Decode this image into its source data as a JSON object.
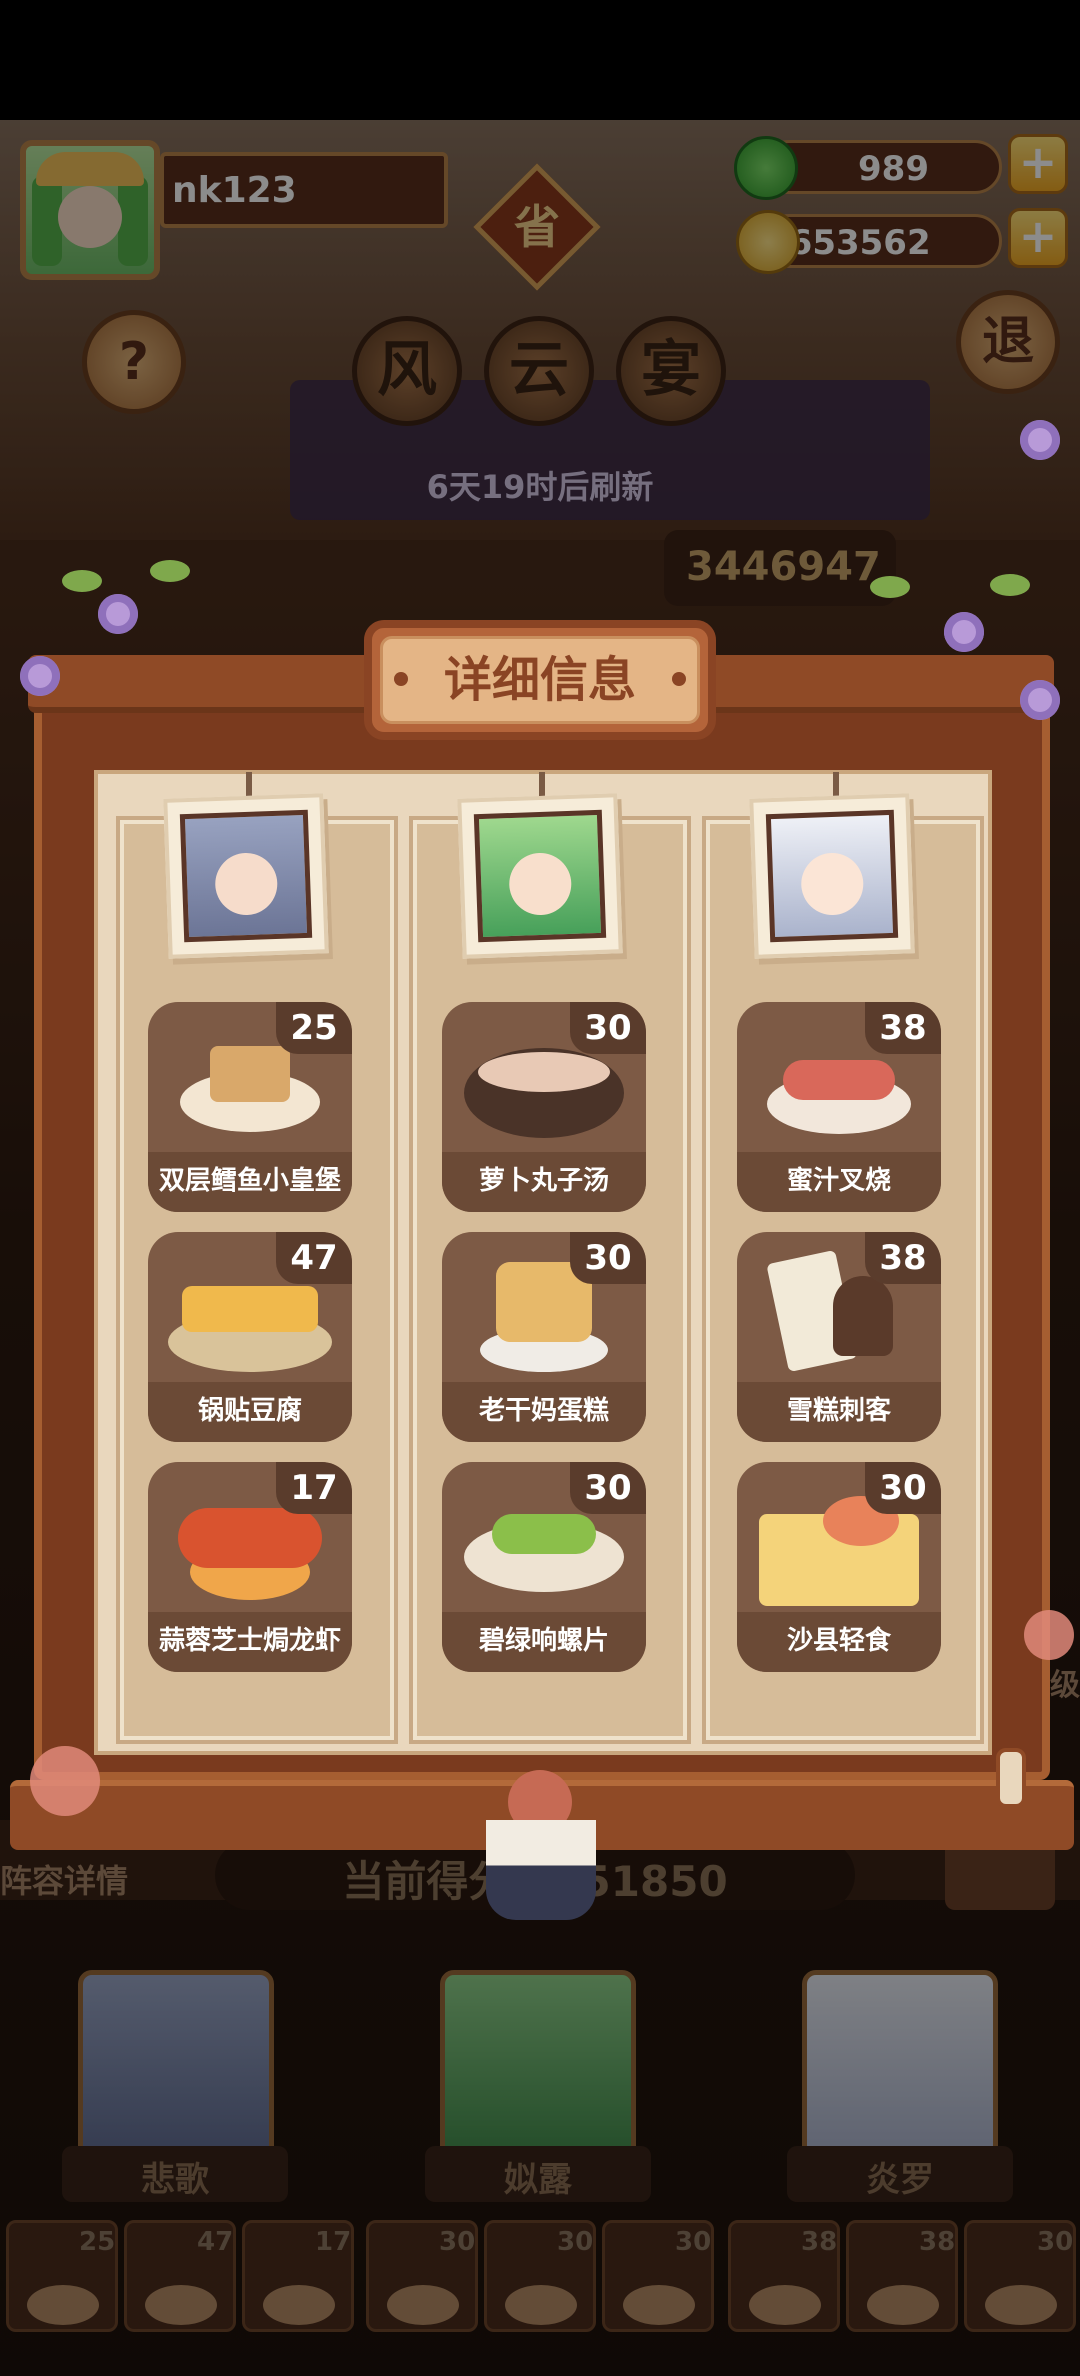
{
  "player": {
    "name": "nk123"
  },
  "resources": {
    "gems": "989",
    "coins": "1653562"
  },
  "header": {
    "help_label": "?",
    "exit_label": "退",
    "province_label": "省",
    "title_chars": [
      "风",
      "云",
      "宴"
    ],
    "refresh_text": "6天19时后刷新",
    "score_chip": "3446947"
  },
  "panel": {
    "title": "详细信息",
    "columns": [
      {
        "character": "悲歌",
        "dishes": [
          {
            "name": "双层鳕鱼小皇堡",
            "value": "25"
          },
          {
            "name": "锅贴豆腐",
            "value": "47"
          },
          {
            "name": "蒜蓉芝士焗龙虾",
            "value": "17"
          }
        ]
      },
      {
        "character": "姒露",
        "dishes": [
          {
            "name": "萝卜丸子汤",
            "value": "30"
          },
          {
            "name": "老干妈蛋糕",
            "value": "30"
          },
          {
            "name": "碧绿响螺片",
            "value": "30"
          }
        ]
      },
      {
        "character": "炎罗",
        "dishes": [
          {
            "name": "蜜汁叉烧",
            "value": "38"
          },
          {
            "name": "雪糕刺客",
            "value": "38"
          },
          {
            "name": "沙县轻食",
            "value": "30"
          }
        ]
      }
    ]
  },
  "background": {
    "lineup_label": "阵容详情",
    "current_score": "当前得分：351850",
    "side_label": "级",
    "characters": [
      "悲歌",
      "姒露",
      "炎罗"
    ],
    "dish_strip": [
      "25",
      "47",
      "17",
      "30",
      "30",
      "30",
      "38",
      "38",
      "30"
    ]
  },
  "colors": {
    "panel_wood": "#7a3a1e",
    "paper": "#e9d7bd",
    "dish_card": "#7d5a45",
    "accent_gold": "#f0a823"
  }
}
